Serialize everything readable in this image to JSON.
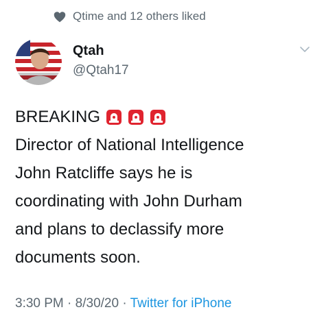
{
  "social_context": {
    "icon": "heart-icon",
    "text": "Qtime and 12 others liked"
  },
  "author": {
    "display_name": "Qtah",
    "handle": "@Qtah17",
    "avatar_icon": "avatar-flag-photo"
  },
  "menu_icon": "chevron-down-icon",
  "tweet": {
    "headline": "BREAKING",
    "headline_icons": [
      "siren-icon",
      "siren-icon",
      "siren-icon"
    ],
    "lines": [
      "Director of National Intelligence",
      "John Ratcliffe says he is",
      "coordinating with John Durham",
      "and plans to declassify more",
      "documents soon."
    ]
  },
  "meta": {
    "time": "3:30 PM",
    "separator": "·",
    "date": "8/30/20",
    "source": "Twitter for iPhone"
  },
  "colors": {
    "text": "#14171a",
    "secondary": "#5b6770",
    "link": "#1b95e0",
    "siren": "#e0242f"
  }
}
